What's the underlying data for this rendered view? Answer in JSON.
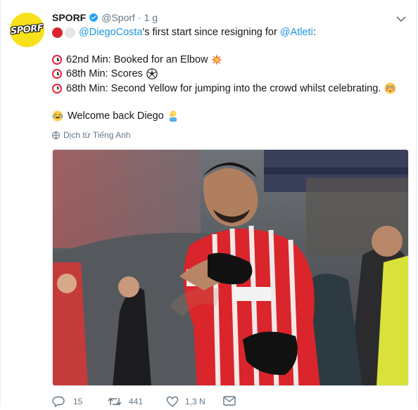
{
  "tweet": {
    "avatar_text": "SPORF",
    "display_name": "SPORF",
    "handle": "@Sporf",
    "separator": "·",
    "time": "1 g",
    "line1_mention1": "@DiegoCosta",
    "line1_middle": "'s first start since resigning for ",
    "line1_mention2": "@Atleti",
    "line1_end": ":",
    "items": [
      "62nd Min: Booked for an Elbow",
      "68th Min: Scores",
      "68th Min: Second Yellow for jumping into the crowd whilst celebrating."
    ],
    "closing": "Welcome back Diego",
    "translate": "Dịch từ Tiếng Anh"
  },
  "actions": {
    "replies": "15",
    "retweets": "441",
    "likes": "1,3 N"
  },
  "colors": {
    "accent": "#1b95e0",
    "muted": "#657786",
    "avatar_bg": "#f8e11a",
    "clock_red": "#e0243d"
  },
  "icons": [
    "verified-badge-icon",
    "chevron-down-icon",
    "globe-icon",
    "alarm-clock-emoji",
    "collision-emoji",
    "soccer-ball-emoji",
    "flushed-face-emoji",
    "laughing-tears-emoji",
    "facepalm-emoji",
    "reply-icon",
    "retweet-icon",
    "like-icon",
    "message-icon"
  ]
}
